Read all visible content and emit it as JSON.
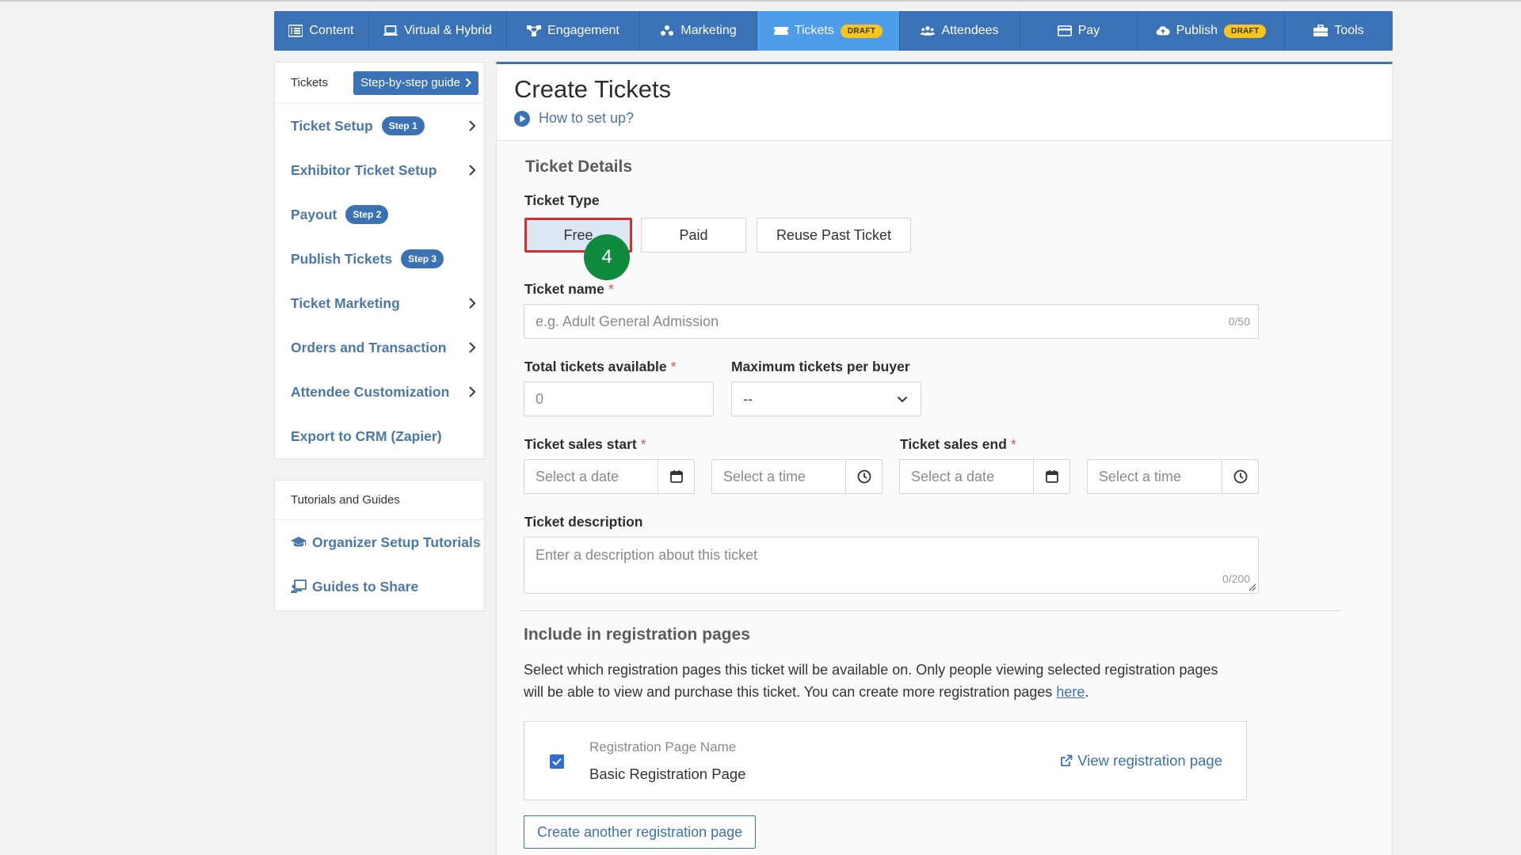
{
  "topnav": {
    "items": [
      {
        "label": "Content",
        "icon": "list-icon"
      },
      {
        "label": "Virtual & Hybrid",
        "icon": "laptop-icon"
      },
      {
        "label": "Engagement",
        "icon": "network-icon"
      },
      {
        "label": "Marketing",
        "icon": "marketing-icon"
      },
      {
        "label": "Tickets",
        "icon": "ticket-icon",
        "badge": "DRAFT",
        "active": true
      },
      {
        "label": "Attendees",
        "icon": "users-icon"
      },
      {
        "label": "Pay",
        "icon": "credit-card-icon"
      },
      {
        "label": "Publish",
        "icon": "cloud-upload-icon",
        "badge": "DRAFT"
      },
      {
        "label": "Tools",
        "icon": "toolbox-icon"
      }
    ]
  },
  "sidebar": {
    "heading": "Tickets",
    "guide_button": "Step-by-step guide",
    "items": [
      {
        "label": "Ticket Setup",
        "step": "Step 1",
        "chevron": true
      },
      {
        "label": "Exhibitor Ticket Setup",
        "step": "",
        "chevron": true
      },
      {
        "label": "Payout",
        "step": "Step 2",
        "chevron": false
      },
      {
        "label": "Publish Tickets",
        "step": "Step 3",
        "chevron": false
      },
      {
        "label": "Ticket Marketing",
        "step": "",
        "chevron": true
      },
      {
        "label": "Orders and Transaction",
        "step": "",
        "chevron": true
      },
      {
        "label": "Attendee Customization",
        "step": "",
        "chevron": true
      },
      {
        "label": "Export to CRM (Zapier)",
        "step": "",
        "chevron": false
      }
    ]
  },
  "tutorials": {
    "heading": "Tutorials and Guides",
    "items": [
      {
        "label": "Organizer Setup Tutorials",
        "icon": "graduation-cap-icon"
      },
      {
        "label": "Guides to Share",
        "icon": "chalkboard-icon"
      }
    ]
  },
  "main": {
    "title": "Create Tickets",
    "howto": "How to set up?",
    "section_title": "Ticket Details",
    "ticket_type": {
      "label": "Ticket Type",
      "options": [
        "Free",
        "Paid",
        "Reuse Past Ticket"
      ],
      "selected": "Free"
    },
    "step_marker": "4",
    "ticket_name": {
      "label": "Ticket name",
      "required": "*",
      "placeholder": "e.g. Adult General Admission",
      "counter": "0/50"
    },
    "total_tickets": {
      "label": "Total tickets available",
      "required": "*",
      "value": "0"
    },
    "max_per_buyer": {
      "label": "Maximum tickets per buyer",
      "value": "--"
    },
    "sales_start": {
      "label": "Ticket sales start",
      "required": "*",
      "date_placeholder": "Select a date",
      "time_placeholder": "Select a time"
    },
    "sales_end": {
      "label": "Ticket sales end",
      "required": "*",
      "date_placeholder": "Select a date",
      "time_placeholder": "Select a time"
    },
    "description": {
      "label": "Ticket description",
      "placeholder": "Enter a description about this ticket",
      "counter": "0/200"
    },
    "registration": {
      "title": "Include in registration pages",
      "desc_before": "Select which registration pages this ticket will be available on. Only people viewing selected registration pages will be able to view and purchase this ticket. You can create more registration pages ",
      "desc_link": "here",
      "desc_after": ".",
      "column_header": "Registration Page Name",
      "page_name": "Basic Registration Page",
      "checked": true,
      "view_link": "View registration page",
      "create_button": "Create another registration page"
    }
  },
  "colors": {
    "nav_bg": "#3a72b5",
    "nav_active": "#4d9de8",
    "draft_badge": "#f8c51c",
    "link": "#4a78ab",
    "highlight_border": "#d32f2f",
    "marker": "#0f8a3f"
  }
}
